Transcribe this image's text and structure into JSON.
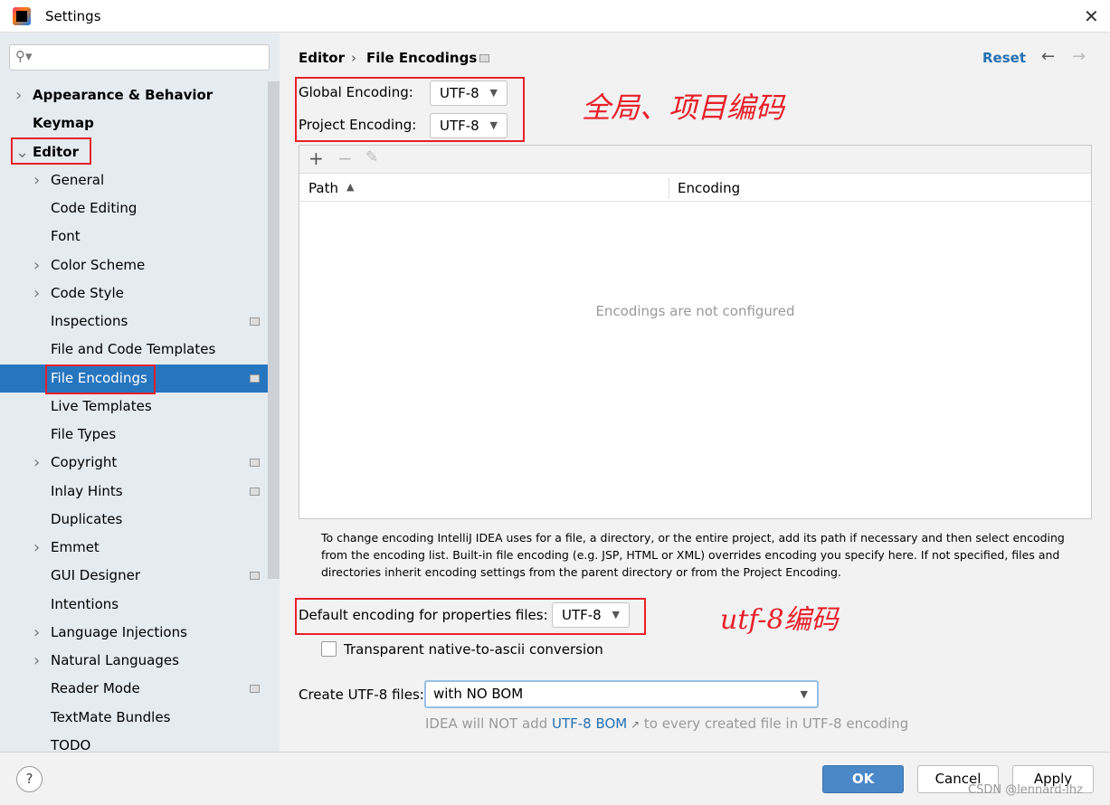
{
  "window": {
    "title": "Settings"
  },
  "search": {
    "placeholder": ""
  },
  "sidebar": {
    "items": [
      {
        "label": "Appearance & Behavior",
        "bold": true,
        "expandable": true,
        "expanded": false,
        "level": 0
      },
      {
        "label": "Keymap",
        "bold": true,
        "level": 0
      },
      {
        "label": "Editor",
        "bold": true,
        "expandable": true,
        "expanded": true,
        "level": 0
      },
      {
        "label": "General",
        "expandable": true,
        "level": 1
      },
      {
        "label": "Code Editing",
        "level": 1
      },
      {
        "label": "Font",
        "level": 1
      },
      {
        "label": "Color Scheme",
        "expandable": true,
        "level": 1
      },
      {
        "label": "Code Style",
        "expandable": true,
        "level": 1
      },
      {
        "label": "Inspections",
        "level": 1,
        "project_icon": true
      },
      {
        "label": "File and Code Templates",
        "level": 1
      },
      {
        "label": "File Encodings",
        "level": 1,
        "selected": true,
        "project_icon": true
      },
      {
        "label": "Live Templates",
        "level": 1
      },
      {
        "label": "File Types",
        "level": 1
      },
      {
        "label": "Copyright",
        "expandable": true,
        "level": 1,
        "project_icon": true
      },
      {
        "label": "Inlay Hints",
        "level": 1,
        "project_icon": true
      },
      {
        "label": "Duplicates",
        "level": 1
      },
      {
        "label": "Emmet",
        "expandable": true,
        "level": 1
      },
      {
        "label": "GUI Designer",
        "level": 1,
        "project_icon": true
      },
      {
        "label": "Intentions",
        "level": 1
      },
      {
        "label": "Language Injections",
        "expandable": true,
        "level": 1
      },
      {
        "label": "Natural Languages",
        "expandable": true,
        "level": 1
      },
      {
        "label": "Reader Mode",
        "level": 1,
        "project_icon": true
      },
      {
        "label": "TextMate Bundles",
        "level": 1
      },
      {
        "label": "TODO",
        "level": 1
      }
    ]
  },
  "breadcrumb": {
    "parent": "Editor",
    "current": "File Encodings"
  },
  "header": {
    "reset": "Reset"
  },
  "encodings": {
    "global_label": "Global Encoding:",
    "global_value": "UTF-8",
    "project_label": "Project Encoding:",
    "project_value": "UTF-8"
  },
  "annotations": {
    "global_project": "全局、项目编码",
    "utf8": "utf-8编码"
  },
  "table": {
    "columns": [
      "Path",
      "Encoding"
    ],
    "empty_text": "Encodings are not configured"
  },
  "info": "To change encoding IntelliJ IDEA uses for a file, a directory, or the entire project, add its path if necessary and then select encoding from the encoding list. Built-in file encoding (e.g. JSP, HTML or XML) overrides encoding you specify here. If not specified, files and directories inherit encoding settings from the parent directory or from the Project Encoding.",
  "properties": {
    "label": "Default encoding for properties files:",
    "value": "UTF-8",
    "transparent_label": "Transparent native-to-ascii conversion",
    "transparent_checked": false
  },
  "bom": {
    "label": "Create UTF-8 files:",
    "value": "with NO BOM",
    "hint_pre": "IDEA will NOT add ",
    "hint_link": "UTF-8 BOM",
    "hint_post": " to every created file in UTF-8 encoding"
  },
  "buttons": {
    "ok": "OK",
    "cancel": "Cancel",
    "apply": "Apply"
  },
  "watermark": "CSDN @lennard-lhz",
  "colors": {
    "accent": "#2675bf",
    "annotation": "#e8202a",
    "link": "#2470b3"
  }
}
